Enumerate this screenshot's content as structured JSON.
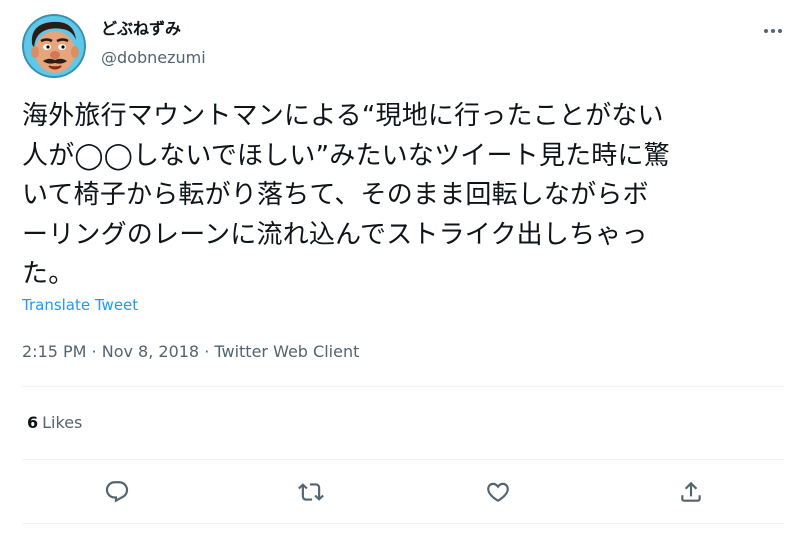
{
  "author": {
    "display_name": "どぶねずみ",
    "handle": "@dobnezumi",
    "avatar_icon": "cartoon-face-avatar"
  },
  "tweet": {
    "text": "海外旅行マウントマンによる“現地に行ったことがない\n人が◯◯しないでほしい”みたいなツイート見た時に驚\nいて椅子から転がり落ちて、そのまま回転しながらボ\nーリングのレーンに流れ込んでストライク出しちゃっ\nた。",
    "translate_label": "Translate Tweet",
    "meta": "2:15 PM · Nov 8, 2018 · Twitter Web Client"
  },
  "stats": {
    "likes_count": "6",
    "likes_label": "Likes"
  },
  "actions": {
    "reply_icon": "reply-icon",
    "retweet_icon": "retweet-icon",
    "like_icon": "heart-icon",
    "share_icon": "share-icon"
  },
  "colors": {
    "link": "#1d9bf0",
    "secondary_text": "#536471",
    "primary_text": "#0f1419",
    "divider": "#eff3f4"
  }
}
